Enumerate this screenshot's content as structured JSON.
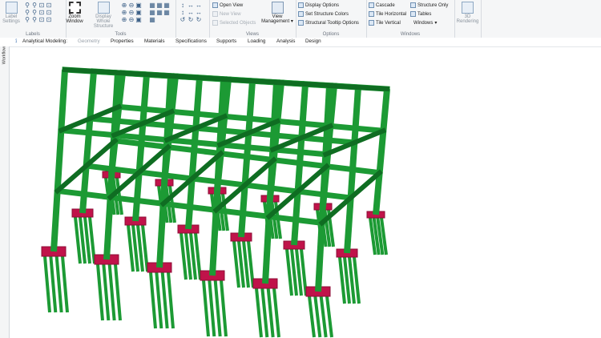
{
  "ribbon": {
    "labels_group": {
      "label": "Labels",
      "label_settings": "Label Settings"
    },
    "tools_group": {
      "label": "Tools",
      "zoom_window": "Zoom Window",
      "display_whole_structure": "Display Whole Structure"
    },
    "views_group": {
      "label": "Views",
      "open_view": "Open View",
      "new_view": "New View",
      "selected_objects": "Selected Objects",
      "view_management": "View Management"
    },
    "options_group": {
      "label": "Options",
      "display_options": "Display Options",
      "set_structure_colors": "Set Structure Colors",
      "structural_tooltip_options": "Structural Tooltip Options"
    },
    "windows_group": {
      "label": "Windows",
      "cascade": "Cascade",
      "tile_horizontal": "Tile Horizontal",
      "tile_vertical": "Tile Vertical",
      "structure_only": "Structure Only",
      "tables": "Tables",
      "windows": "Windows"
    },
    "rendering_group": {
      "rendering_3d": "3D Rendering"
    }
  },
  "tabs": [
    {
      "label": "Analytical Modeling:"
    },
    {
      "label": "Geometry"
    },
    {
      "label": "Properties"
    },
    {
      "label": "Materials"
    },
    {
      "label": "Specifications"
    },
    {
      "label": "Supports"
    },
    {
      "label": "Loading"
    },
    {
      "label": "Analysis"
    },
    {
      "label": "Design"
    }
  ],
  "workflow": {
    "label": "Workflow"
  },
  "colors": {
    "member": "#1c9a34",
    "member_dark": "#0f6d22",
    "footing": "#c0134a",
    "footing_dark": "#8e0d37"
  }
}
